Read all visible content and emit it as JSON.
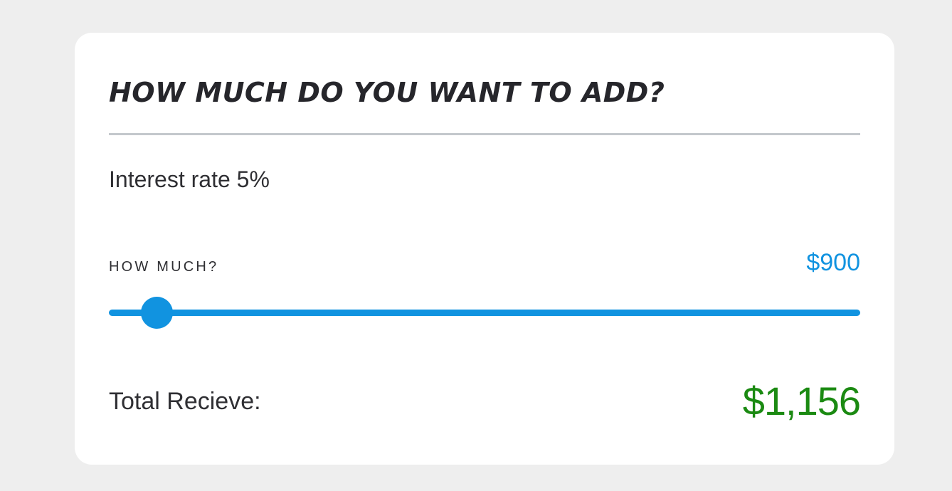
{
  "card": {
    "title": "HOW MUCH DO YOU WANT TO ADD?",
    "interest_text": "Interest rate 5%",
    "amount_label": "HOW MUCH?",
    "amount_value": "$900",
    "slider": {
      "value": 900,
      "fraction": 0.0635
    },
    "total_label": "Total Recieve:",
    "total_value": "$1,156"
  },
  "colors": {
    "background": "#eeeeee",
    "card": "#ffffff",
    "heading": "#26262b",
    "text": "#2f2f33",
    "divider": "#c4c8cc",
    "accent_blue": "#1193e0",
    "total_green": "#1b8a12"
  }
}
